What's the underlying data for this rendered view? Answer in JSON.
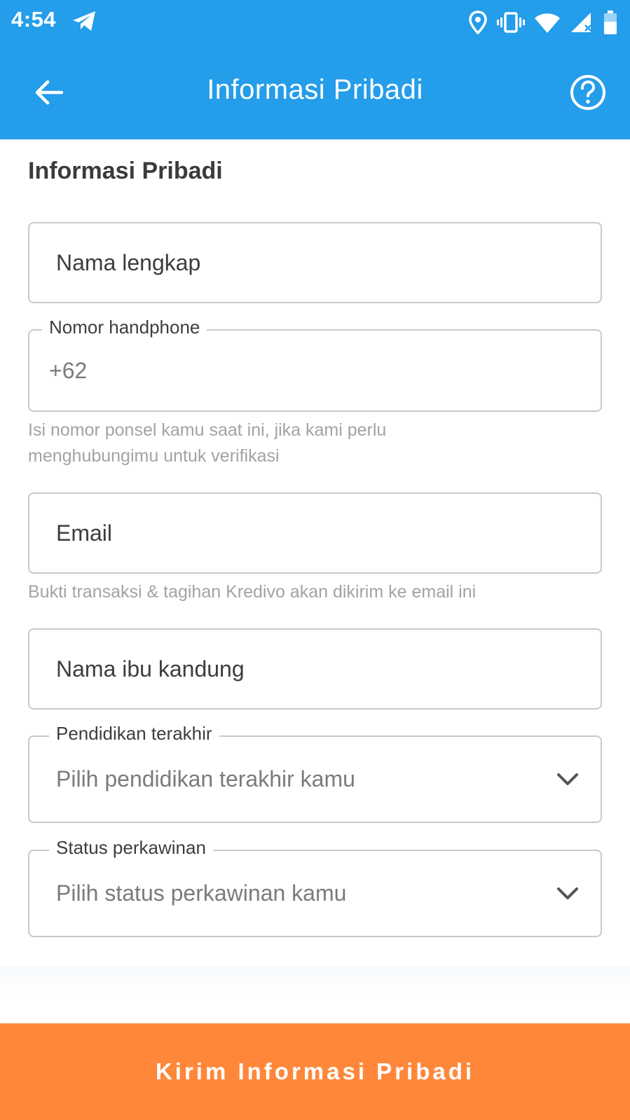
{
  "status_bar": {
    "time": "4:54",
    "icons": [
      "telegram-icon",
      "location-icon",
      "vibrate-icon",
      "wifi-icon",
      "signal-icon",
      "battery-icon"
    ]
  },
  "app_bar": {
    "title": "Informasi Pribadi",
    "back_icon": "arrow-left-icon",
    "help_icon": "help-circle-icon",
    "background": "#249DEA"
  },
  "form": {
    "section_title": "Informasi Pribadi",
    "full_name": {
      "placeholder": "Nama lengkap"
    },
    "phone": {
      "label": "Nomor handphone",
      "value": "+62",
      "helper": "Isi nomor ponsel kamu saat ini, jika kami perlu menghubungimu untuk verifikasi"
    },
    "email": {
      "placeholder": "Email",
      "helper": "Bukti transaksi & tagihan Kredivo akan dikirim ke email ini"
    },
    "mother_name": {
      "placeholder": "Nama ibu kandung"
    },
    "education": {
      "label": "Pendidikan terakhir",
      "placeholder": "Pilih pendidikan terakhir kamu"
    },
    "marital_status": {
      "label": "Status perkawinan",
      "placeholder": "Pilih status perkawinan kamu"
    }
  },
  "submit": {
    "label": "Kirim Informasi Pribadi",
    "color": "#FF873A"
  }
}
